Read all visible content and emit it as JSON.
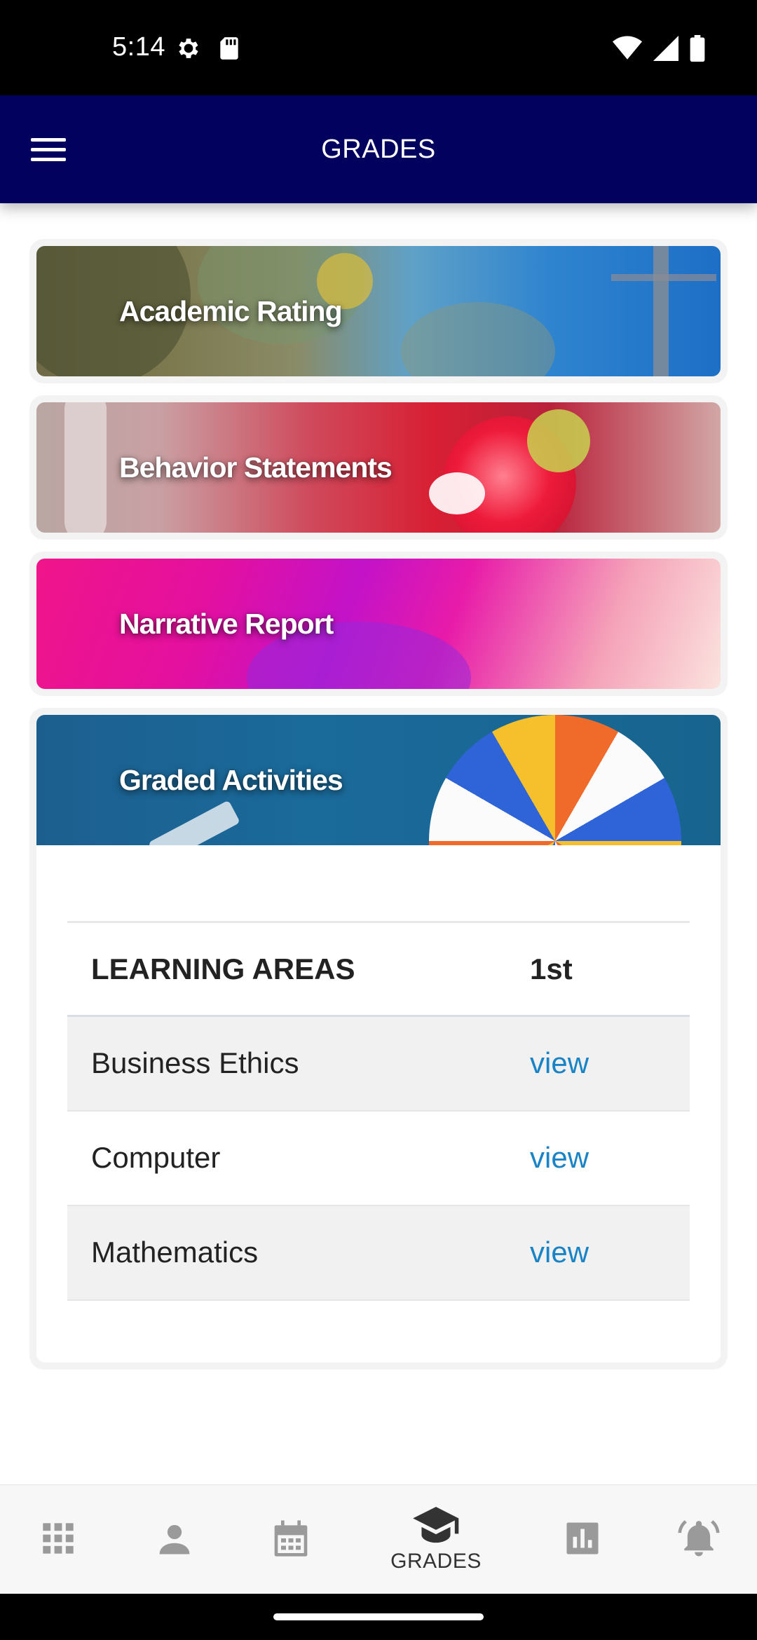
{
  "status_bar": {
    "time": "5:14",
    "left_icons": [
      "settings-gear-icon",
      "sd-card-icon"
    ],
    "right_icons": [
      "wifi-icon",
      "cell-signal-icon",
      "battery-icon"
    ]
  },
  "app_bar": {
    "title": "GRADES",
    "menu_icon": "hamburger-menu-icon"
  },
  "cards": [
    {
      "label": "Academic Rating"
    },
    {
      "label": "Behavior Statements"
    },
    {
      "label": "Narrative Report"
    },
    {
      "label": "Graded Activities"
    }
  ],
  "table": {
    "headers": [
      "LEARNING AREAS",
      "1st"
    ],
    "rows": [
      {
        "subject": "Business Ethics",
        "action": "view"
      },
      {
        "subject": "Computer",
        "action": "view"
      },
      {
        "subject": "Mathematics",
        "action": "view"
      }
    ]
  },
  "bottom_nav": {
    "items": [
      {
        "icon": "apps-grid-icon",
        "label": ""
      },
      {
        "icon": "person-icon",
        "label": ""
      },
      {
        "icon": "calendar-icon",
        "label": ""
      },
      {
        "icon": "graduation-cap-icon",
        "label": "GRADES",
        "active": true
      },
      {
        "icon": "bar-chart-icon",
        "label": ""
      },
      {
        "icon": "notification-bell-icon",
        "label": ""
      }
    ]
  },
  "colors": {
    "app_bar": "#03015e",
    "link": "#1883c5",
    "nav_icon": "#9a9a9a",
    "nav_active": "#333333"
  }
}
